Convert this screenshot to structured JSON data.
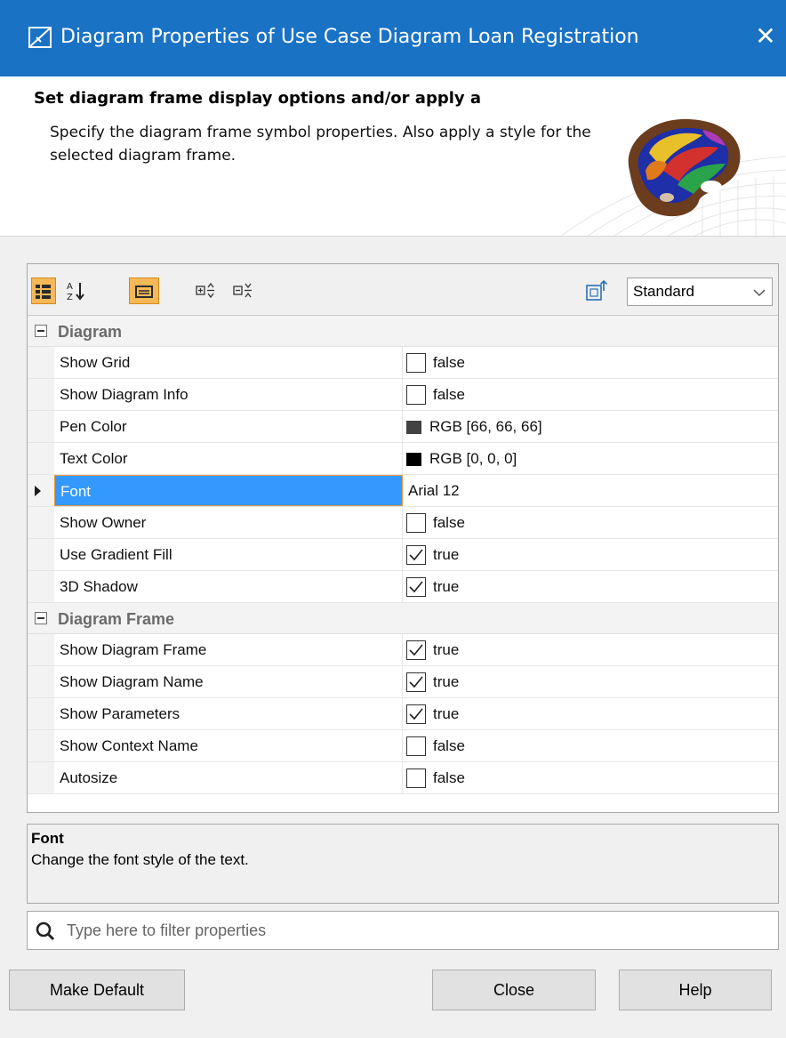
{
  "window": {
    "title": "Diagram Properties of Use Case Diagram Loan Registration",
    "close_glyph": "✕"
  },
  "header": {
    "heading": "Set diagram frame display options and/or apply a",
    "description": "Specify the diagram frame symbol properties. Also apply a style for the selected diagram frame."
  },
  "toolbar": {
    "style_select": "Standard",
    "buttons": [
      "categorized-view",
      "sort-alphabetically",
      "show-description",
      "expand-all",
      "collapse-all"
    ]
  },
  "groups": [
    {
      "label": "Diagram",
      "properties": [
        {
          "name": "Show Grid",
          "type": "checkbox",
          "checked": false,
          "value": "false"
        },
        {
          "name": "Show Diagram Info",
          "type": "checkbox",
          "checked": false,
          "value": "false"
        },
        {
          "name": "Pen Color",
          "type": "color",
          "color": "#424242",
          "value": "RGB [66, 66, 66]"
        },
        {
          "name": "Text Color",
          "type": "color",
          "color": "#000000",
          "value": "RGB [0, 0, 0]"
        },
        {
          "name": "Font",
          "type": "text",
          "value": "Arial 12",
          "selected": true
        },
        {
          "name": "Show Owner",
          "type": "checkbox",
          "checked": false,
          "value": "false"
        },
        {
          "name": "Use Gradient Fill",
          "type": "checkbox",
          "checked": true,
          "value": "true"
        },
        {
          "name": "3D Shadow",
          "type": "checkbox",
          "checked": true,
          "value": "true"
        }
      ]
    },
    {
      "label": "Diagram Frame",
      "properties": [
        {
          "name": "Show Diagram Frame",
          "type": "checkbox",
          "checked": true,
          "value": "true"
        },
        {
          "name": "Show Diagram Name",
          "type": "checkbox",
          "checked": true,
          "value": "true"
        },
        {
          "name": "Show Parameters",
          "type": "checkbox",
          "checked": true,
          "value": "true"
        },
        {
          "name": "Show Context Name",
          "type": "checkbox",
          "checked": false,
          "value": "false"
        },
        {
          "name": "Autosize",
          "type": "checkbox",
          "checked": false,
          "value": "false"
        }
      ]
    }
  ],
  "description_pane": {
    "title": "Font",
    "text": "Change the font style of the text."
  },
  "filter": {
    "placeholder": "Type here to filter properties"
  },
  "buttons": {
    "make_default": "Make Default",
    "close": "Close",
    "help": "Help"
  },
  "colors": {
    "titlebar": "#1a72c4",
    "selection": "#3399ff",
    "active_toolbar": "#f7b957"
  }
}
